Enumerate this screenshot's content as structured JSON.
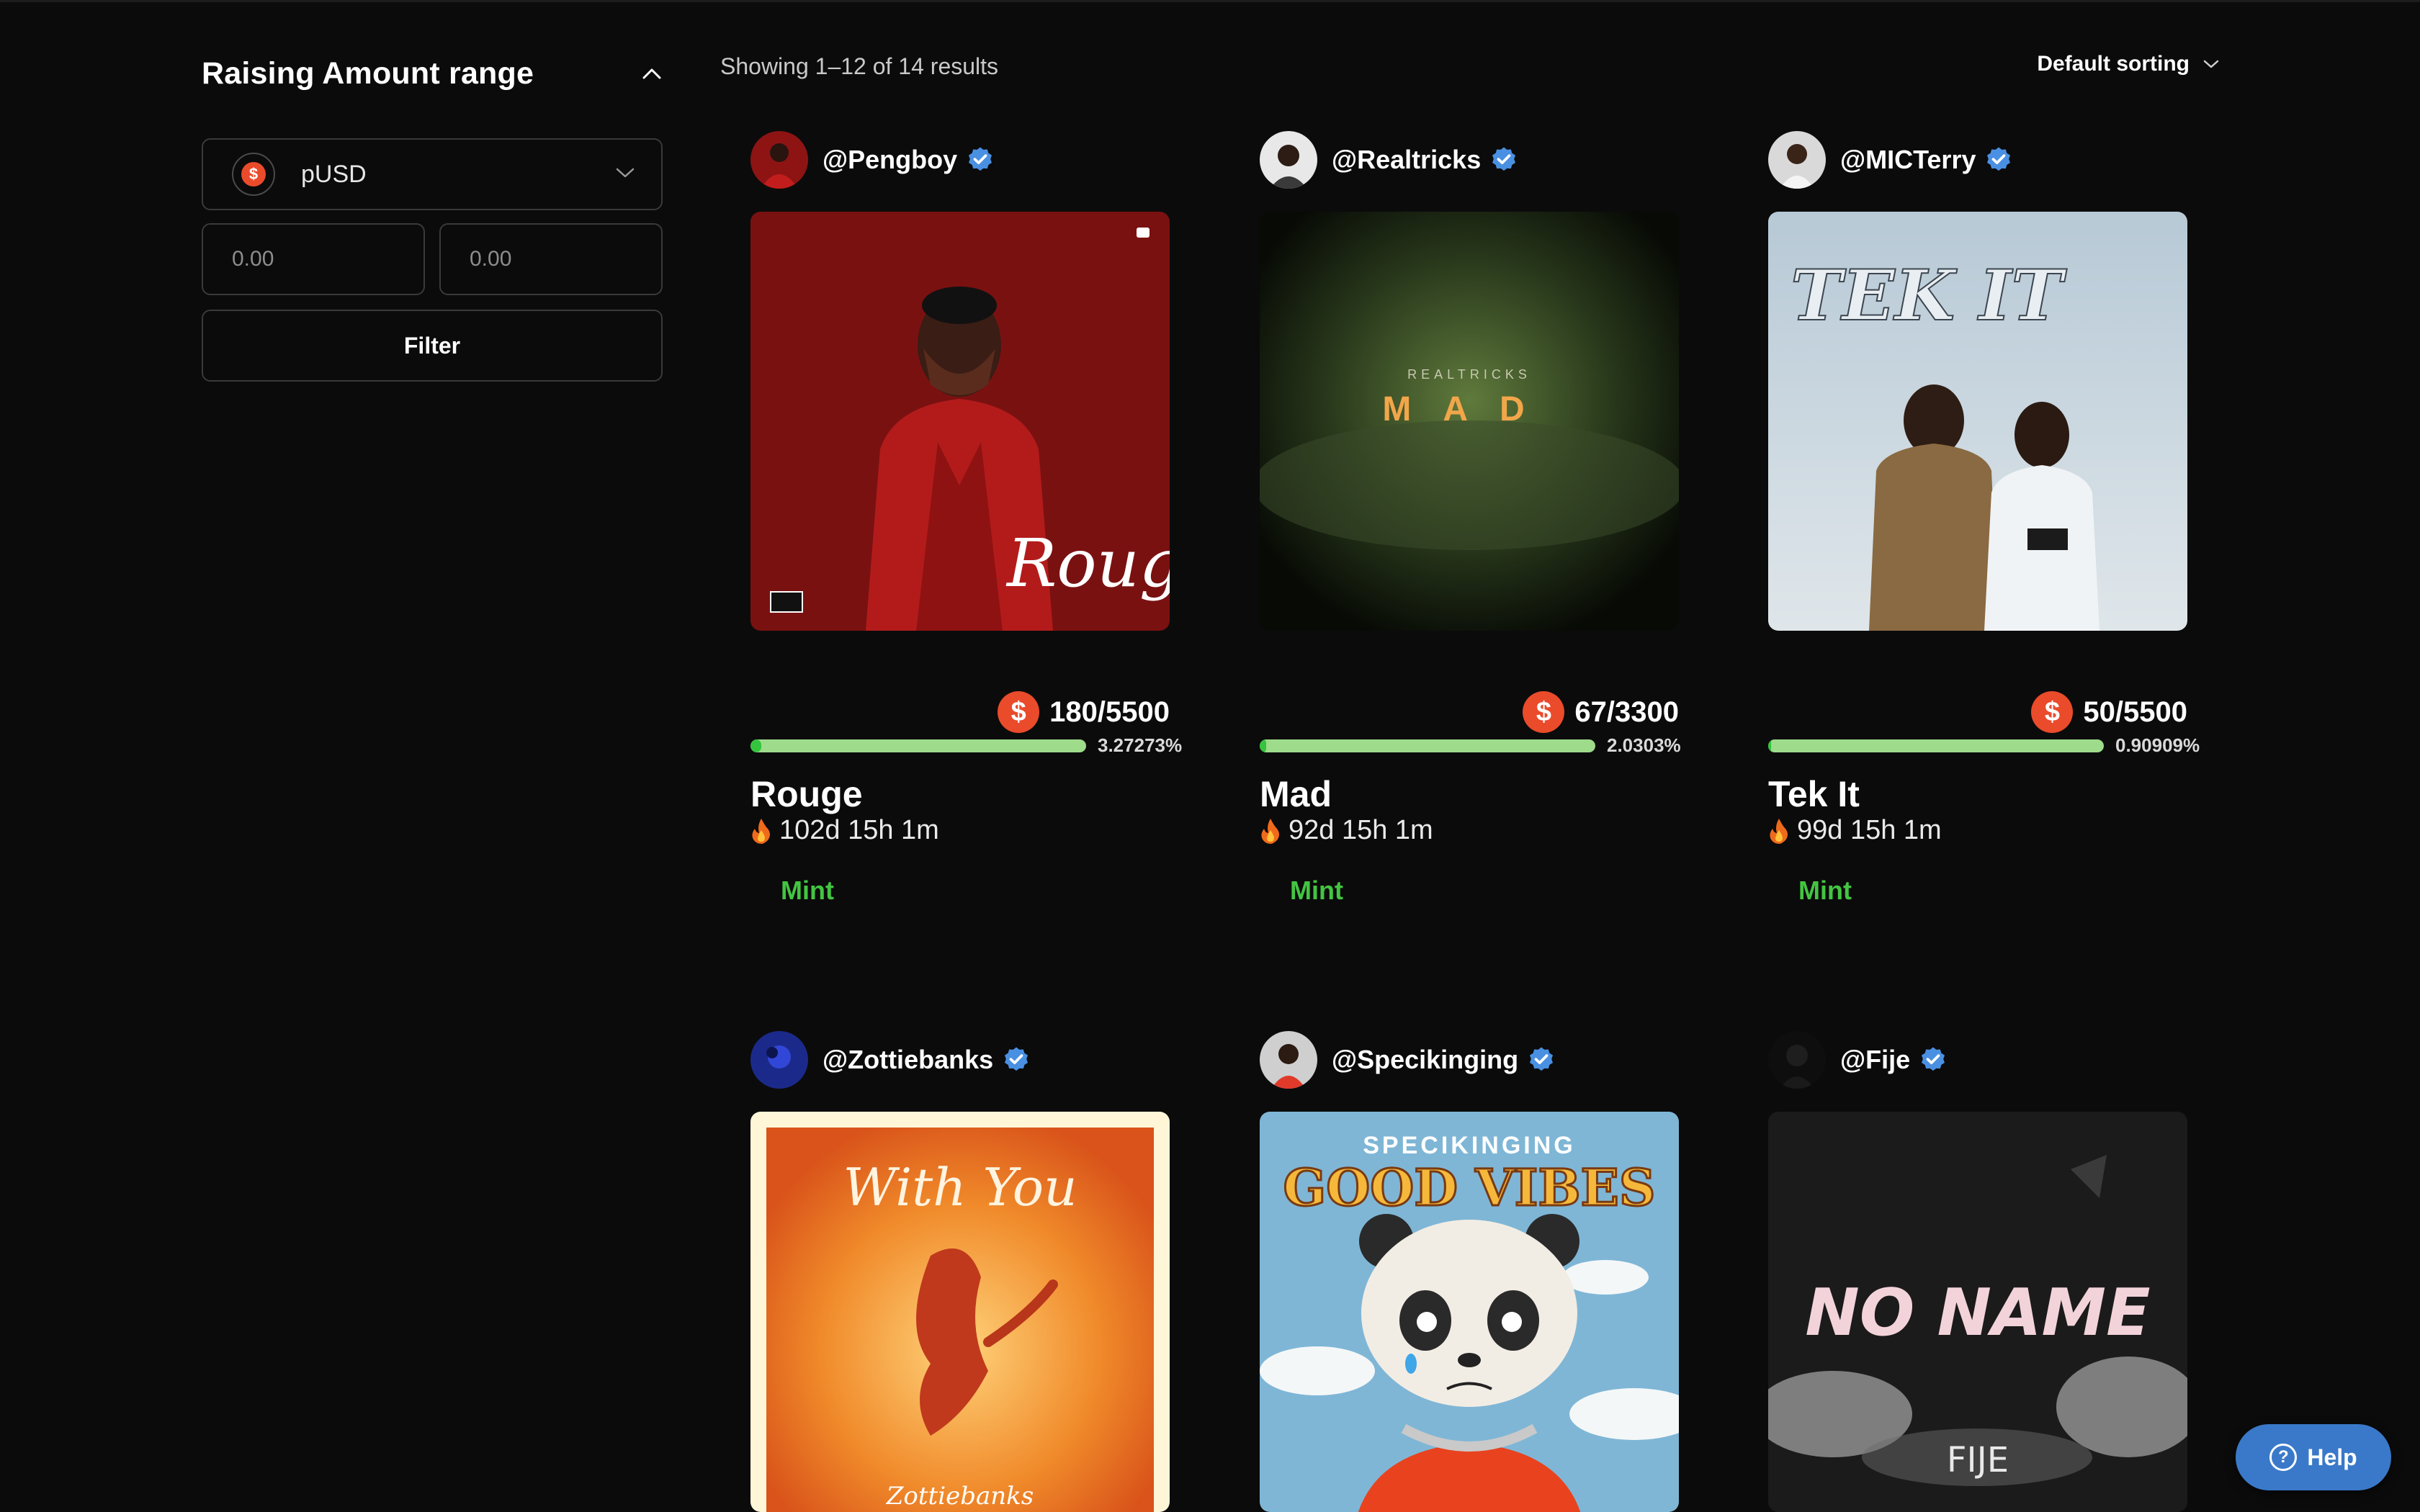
{
  "sidebar": {
    "title": "Raising Amount range",
    "token": "pUSD",
    "coin_symbol": "$",
    "min_placeholder": "0.00",
    "max_placeholder": "0.00",
    "filter_label": "Filter"
  },
  "results": {
    "summary": "Showing 1–12 of 14 results",
    "sorting": "Default sorting"
  },
  "cards": [
    {
      "handle": "@Pengboy",
      "price": "180/5500",
      "progress": 3.27273,
      "percent": "3.27273%",
      "title": "Rouge",
      "timer": "102d 15h 1m",
      "mint": "Mint",
      "cover_text": "Rouge"
    },
    {
      "handle": "@Realtricks",
      "price": "67/3300",
      "progress": 2.0303,
      "percent": "2.0303%",
      "title": "Mad",
      "timer": "92d 15h 1m",
      "mint": "Mint",
      "cover_brand": "REALTRICKS",
      "cover_text": "MAD"
    },
    {
      "handle": "@MICTerry",
      "price": "50/5500",
      "progress": 0.90909,
      "percent": "0.90909%",
      "title": "Tek It",
      "timer": "99d 15h 1m",
      "mint": "Mint",
      "cover_text": "TEK IT"
    },
    {
      "handle": "@Zottiebanks",
      "cover_text": "With You",
      "cover_sub": "Zottiebanks"
    },
    {
      "handle": "@Specikinging",
      "cover_brand": "SPECIKINGING",
      "cover_text": "GOOD VIBES"
    },
    {
      "handle": "@Fije",
      "cover_text": "NO NAME",
      "cover_sub": "FIJE"
    }
  ],
  "help": {
    "label": "Help",
    "icon_glyph": "?"
  },
  "icons": {
    "collapse": "chevron-up-icon",
    "dropdown": "chevron-down-icon",
    "verified": "verified-badge-icon",
    "fire": "fire-icon",
    "coin": "dollar-coin-icon"
  },
  "colors": {
    "background": "#0b0b0b",
    "coin": "#ea4b2b",
    "progress_track": "#9edb8b",
    "progress_fill": "#35c43d",
    "mint": "#43c541",
    "verified": "#4a90e2",
    "help": "#3a79c9"
  }
}
